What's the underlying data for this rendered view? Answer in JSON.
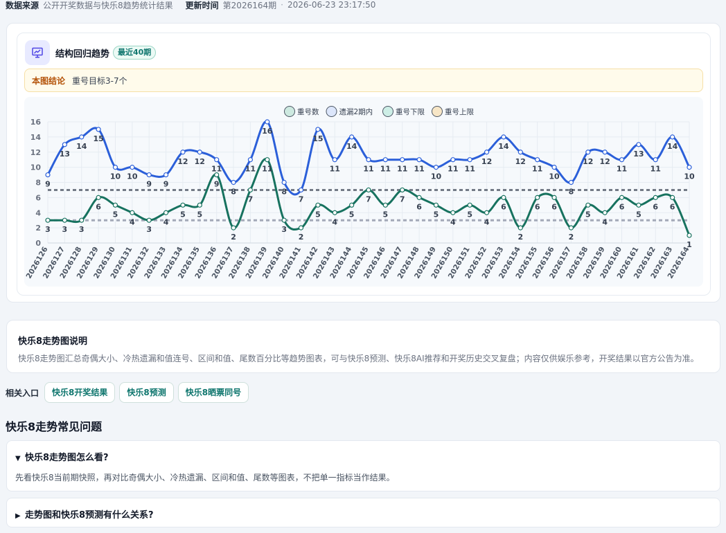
{
  "meta": {
    "source_label": "数据来源",
    "source_value": "公开开奖数据与快乐8趋势统计结果",
    "update_label": "更新时间",
    "update_period": "第2026164期",
    "update_sep": "·",
    "update_time": "2026-06-23 23:17:50"
  },
  "card": {
    "title": "结构回归趋势",
    "badge": "最近40期",
    "icon": "chart-presentation-icon",
    "conclusion_label": "本图结论",
    "conclusion_text": "重号目标3-7个"
  },
  "colors": {
    "blue": "#2b5fd9",
    "green": "#17725f",
    "dash": "#737a86",
    "lower_dash": "#a3a9b8"
  },
  "chart_data": {
    "type": "line",
    "legend_placement": "top-center",
    "legend": [
      "重号数",
      "遗漏2期内",
      "重号下限",
      "重号上限"
    ],
    "legend_colors": [
      "#cde9e0",
      "#dce6fb",
      "#cdeee6",
      "#f7e6c6"
    ],
    "categories": [
      "2026126",
      "2026127",
      "2026128",
      "2026129",
      "2026130",
      "2026131",
      "2026132",
      "2026133",
      "2026134",
      "2026135",
      "2026136",
      "2026137",
      "2026138",
      "2026139",
      "2026140",
      "2026141",
      "2026142",
      "2026143",
      "2026144",
      "2026145",
      "2026146",
      "2026147",
      "2026148",
      "2026149",
      "2026150",
      "2026151",
      "2026152",
      "2026153",
      "2026154",
      "2026155",
      "2026156",
      "2026157",
      "2026158",
      "2026159",
      "2026160",
      "2026161",
      "2026162",
      "2026163",
      "2026164"
    ],
    "series": [
      {
        "name": "重号数",
        "values": [
          3,
          3,
          3,
          6,
          5,
          4,
          3,
          4,
          5,
          5,
          9,
          2,
          7,
          11,
          3,
          2,
          5,
          4,
          5,
          7,
          5,
          7,
          6,
          5,
          4,
          5,
          4,
          6,
          2,
          6,
          6,
          2,
          5,
          4,
          6,
          5,
          6,
          6,
          1
        ]
      },
      {
        "name": "遗漏2期内",
        "values": [
          9,
          13,
          14,
          15,
          10,
          10,
          9,
          9,
          12,
          12,
          11,
          8,
          11,
          16,
          8,
          7,
          15,
          11,
          14,
          11,
          11,
          11,
          11,
          10,
          11,
          11,
          12,
          14,
          12,
          11,
          10,
          8,
          12,
          12,
          11,
          13,
          11,
          14,
          10
        ]
      }
    ],
    "lower_limit": 3,
    "upper_limit": 7,
    "ylim": [
      0,
      16
    ],
    "yticks": [
      0,
      2,
      4,
      6,
      8,
      10,
      12,
      14,
      16
    ],
    "grid": true
  },
  "description": {
    "title": "快乐8走势图说明",
    "text": "快乐8走势图汇总奇偶大小、冷热遗漏和值连号、区间和值、尾数百分比等趋势图表，可与快乐8预测、快乐8AI推荐和开奖历史交叉复盘；内容仅供娱乐参考，开奖结果以官方公告为准。"
  },
  "related": {
    "label": "相关入口",
    "links": [
      "快乐8开奖结果",
      "快乐8预测",
      "快乐8晒票同号"
    ]
  },
  "faq": {
    "heading": "快乐8走势常见问题",
    "items": [
      {
        "marker": "▼",
        "question": "快乐8走势图怎么看?",
        "answer": "先看快乐8当前期快照，再对比奇偶大小、冷热遗漏、区间和值、尾数等图表，不把单一指标当作结果。"
      },
      {
        "marker": "▶",
        "question": "走势图和快乐8预测有什么关系?"
      }
    ]
  }
}
